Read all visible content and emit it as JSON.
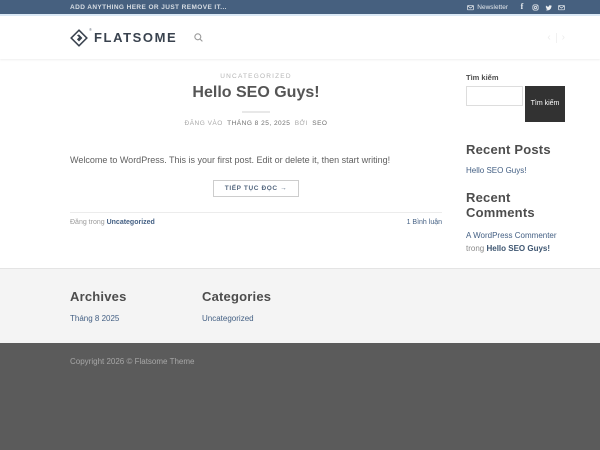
{
  "topbar": {
    "left_text": "ADD ANYTHING HERE OR JUST REMOVE IT...",
    "newsletter_label": "Newsletter",
    "social_icons": [
      "envelope-icon",
      "facebook-icon",
      "instagram-icon",
      "twitter-icon",
      "email-icon"
    ]
  },
  "header": {
    "logo_text": "FLATSOME",
    "reg_mark": "®",
    "search_icon": "search-icon",
    "prev_arrow": "‹",
    "next_arrow": "›"
  },
  "post": {
    "category": "UNCATEGORIZED",
    "title": "Hello SEO Guys!",
    "meta": {
      "prefix": "ĐĂNG VÀO",
      "date": "THÁNG 8 25, 2025",
      "by": "BỞI",
      "author": "SEO"
    },
    "excerpt": "Welcome to WordPress. This is your first post. Edit or delete it, then start writing!",
    "read_more": "TIẾP TỤC ĐỌC →",
    "posted_in": "Đăng trong",
    "category_link": "Uncategorized",
    "comments": "1 Bình luận"
  },
  "sidebar": {
    "search": {
      "label": "Tìm kiếm",
      "input_value": "",
      "button": "Tìm kiếm"
    },
    "recent_posts": {
      "title": "Recent Posts",
      "items": [
        "Hello SEO Guys!"
      ]
    },
    "recent_comments": {
      "title": "Recent Comments",
      "author": "A WordPress Commenter",
      "connector": "trong",
      "post": "Hello SEO Guys!"
    }
  },
  "footer": {
    "archives": {
      "title": "Archives",
      "link": "Tháng 8 2025"
    },
    "categories": {
      "title": "Categories",
      "link": "Uncategorized"
    },
    "copyright": "Copyright 2026 © Flatsome Theme"
  },
  "colors": {
    "primary": "#446084",
    "topbar_bg": "#46607f",
    "topbar_border": "#dbe9f6",
    "link": "#446084",
    "search_button_bg": "#323232",
    "footer_widgets_bg": "#f4f4f4",
    "absolute_footer_bg": "#5b5b5b"
  }
}
